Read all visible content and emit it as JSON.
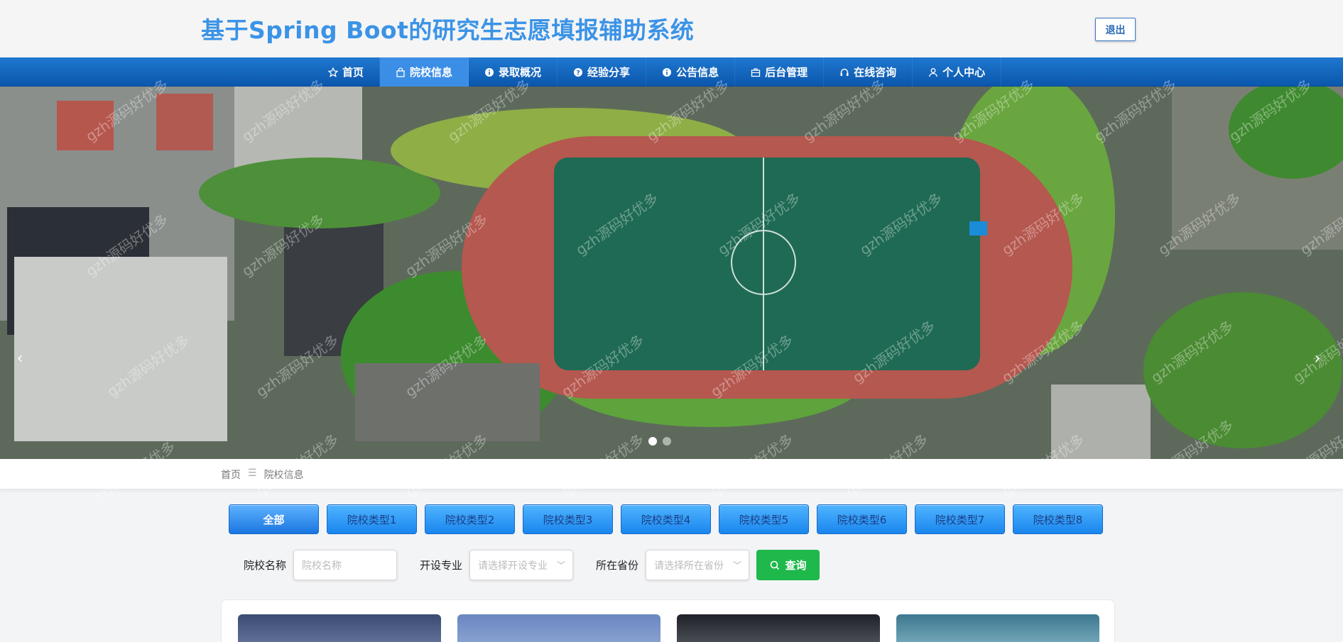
{
  "header": {
    "title": "基于Spring Boot的研究生志愿填报辅助系统",
    "logout_label": "退出"
  },
  "nav": {
    "items": [
      {
        "label": "首页",
        "icon": "star-icon"
      },
      {
        "label": "院校信息",
        "icon": "bag-icon",
        "active": true
      },
      {
        "label": "录取概况",
        "icon": "info-circle-icon"
      },
      {
        "label": "经验分享",
        "icon": "question-circle-icon"
      },
      {
        "label": "公告信息",
        "icon": "info-circle-icon"
      },
      {
        "label": "后台管理",
        "icon": "briefcase-icon"
      },
      {
        "label": "在线咨询",
        "icon": "headset-icon"
      },
      {
        "label": "个人中心",
        "icon": "user-icon"
      }
    ]
  },
  "banner": {
    "prev_arrow": "‹",
    "next_arrow": "›",
    "slide_count": 2,
    "active_slide": 1
  },
  "breadcrumb": {
    "home": "首页",
    "separator": "☰",
    "current": "院校信息"
  },
  "categories": [
    "全部",
    "院校类型1",
    "院校类型2",
    "院校类型3",
    "院校类型4",
    "院校类型5",
    "院校类型6",
    "院校类型7",
    "院校类型8"
  ],
  "search": {
    "name_label": "院校名称",
    "name_placeholder": "院校名称",
    "major_label": "开设专业",
    "major_placeholder": "请选择开设专业",
    "province_label": "所在省份",
    "province_placeholder": "请选择所在省份",
    "button_label": "查询"
  },
  "watermark": "gzh源码好优多",
  "colors": {
    "title": "#3b93e6",
    "nav_bg": "#0b57ad",
    "nav_active": "#3b8ee6",
    "search_button": "#1fb84b",
    "category_button": "#1a86ee"
  }
}
